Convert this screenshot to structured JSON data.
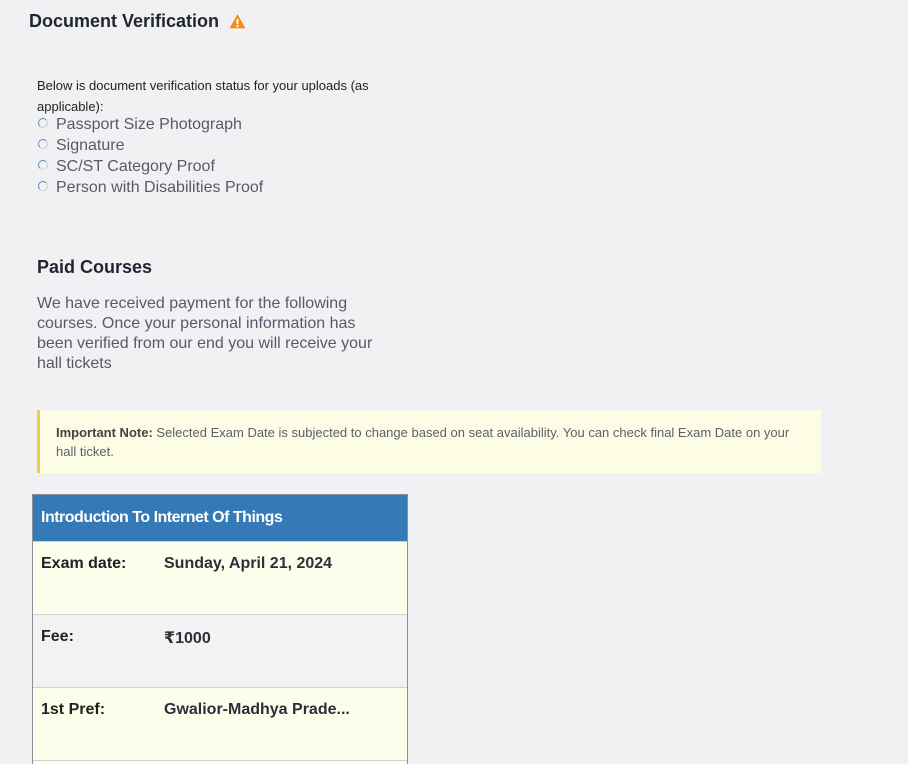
{
  "verification": {
    "title": "Document Verification",
    "intro": "Below is document verification status for your uploads (as applicable):",
    "documents": [
      {
        "label": "Passport Size Photograph"
      },
      {
        "label": "Signature"
      },
      {
        "label": "SC/ST Category Proof"
      },
      {
        "label": "Person with Disabilities Proof"
      }
    ]
  },
  "paid": {
    "title": "Paid Courses",
    "text": "We have received payment for the following courses. Once your personal information has been verified from our end you will receive your hall tickets"
  },
  "note": {
    "label": "Important Note:",
    "text": " Selected Exam Date is subjected to change based on seat availability. You can check final Exam Date on your hall ticket."
  },
  "course": {
    "name": "Introduction To Internet Of Things",
    "rows": [
      {
        "label": "Exam date:",
        "value": "Sunday, April 21, 2024"
      },
      {
        "label": "Fee:",
        "value": "₹1000"
      },
      {
        "label": "1st Pref:",
        "value": "Gwalior-Madhya Prade..."
      }
    ]
  },
  "colors": {
    "header_blue": "#337ab7",
    "note_bg": "#fdfde6",
    "note_border": "#f2cf3c",
    "warning": "#f28c1a"
  }
}
